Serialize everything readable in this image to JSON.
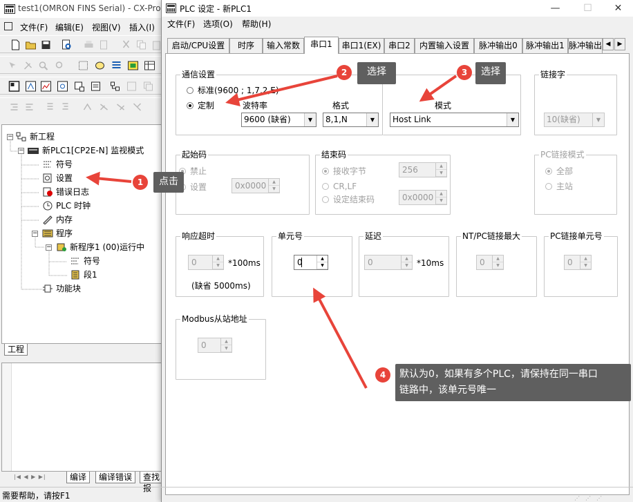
{
  "bg_window": {
    "title": "test1(OMRON FINS Serial) - CX-Pro",
    "menu": [
      "文件(F)",
      "编辑(E)",
      "视图(V)",
      "插入(I)"
    ],
    "tree": {
      "root": "新工程",
      "plc": "新PLC1[CP2E-N] 监视模式",
      "symbols": "符号",
      "settings": "设置",
      "error_log": "错误日志",
      "plc_clock": "PLC 时钟",
      "memory": "内存",
      "programs": "程序",
      "program1": "新程序1 (00)运行中",
      "p_symbols": "符号",
      "section1": "段1",
      "function_blocks": "功能块"
    },
    "project_tab": "工程",
    "bottom_tabs": [
      "编译",
      "编译错误",
      "查找报"
    ],
    "status": "需要帮助，请按F1"
  },
  "dialog": {
    "title": "PLC 设定 - 新PLC1",
    "menu": [
      "文件(F)",
      "选项(O)",
      "帮助(H)"
    ],
    "tabs": [
      "启动/CPU设置",
      "时序",
      "输入常数",
      "串口1",
      "串口1(EX)",
      "串口2",
      "内置输入设置",
      "脉冲输出0",
      "脉冲输出1",
      "脉冲输出"
    ],
    "active_tab": "串口1",
    "comm": {
      "label": "通信设置",
      "standard": "标准(9600 ; 1,7,2,E)",
      "custom": "定制",
      "baud_label": "波特率",
      "baud_value": "9600 (缺省)",
      "format_label": "格式",
      "format_value": "8,1,N",
      "mode_label": "模式",
      "mode_value": "Host Link"
    },
    "link_word": {
      "label": "链接字",
      "value": "10(缺省)"
    },
    "start_code": {
      "label": "起始码",
      "disable": "禁止",
      "set": "设置",
      "value": "0x0000"
    },
    "end_code": {
      "label": "结束码",
      "received_bytes": "接收字节",
      "bytes_value": "256",
      "crlf": "CR,LF",
      "set_end": "设定结束码",
      "value": "0x0000"
    },
    "pc_link_mode": {
      "label": "PC链接模式",
      "all": "全部",
      "master": "主站"
    },
    "response_timeout": {
      "label": "响应超时",
      "value": "0",
      "unit": "*100ms",
      "default": "(缺省 5000ms)"
    },
    "unit_no": {
      "label": "单元号",
      "value": "0"
    },
    "delay": {
      "label": "延迟",
      "value": "0",
      "unit": "*10ms"
    },
    "nt_pc_max": {
      "label": "NT/PC链接最大",
      "value": "0"
    },
    "pc_link_unit": {
      "label": "PC链接单元号",
      "value": "0"
    },
    "modbus": {
      "label": "Modbus从站地址",
      "value": "0"
    }
  },
  "annotations": {
    "a1": {
      "num": "1",
      "text": "点击"
    },
    "a2": {
      "num": "2",
      "text": "选择"
    },
    "a3": {
      "num": "3",
      "text": "选择"
    },
    "a4": {
      "num": "4",
      "text1": "默认为0，如果有多个PLC，请保持在同一串口",
      "text2": "链路中，该单元号唯一"
    }
  },
  "colors": {
    "annotation_red": "#e8443a",
    "annotation_bubble": "#5f5f5f"
  }
}
